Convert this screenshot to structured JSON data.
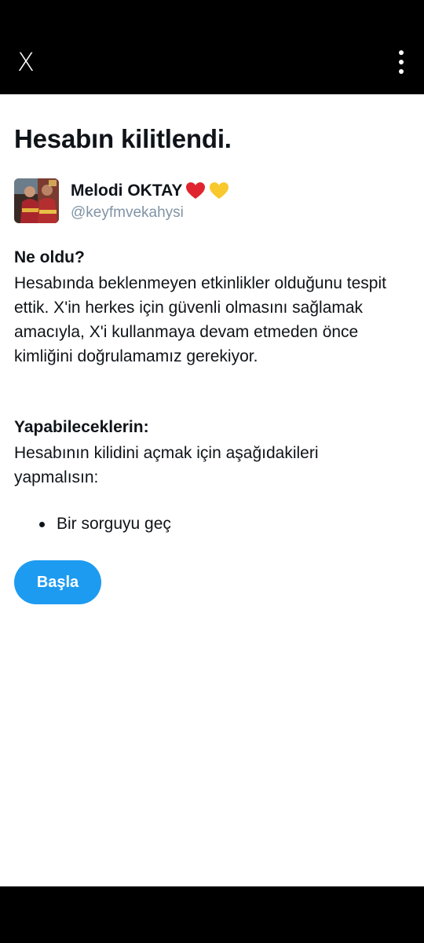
{
  "topbar": {
    "close_label": "X",
    "close_icon": "close-x-icon",
    "more_icon": "more-vertical-icon"
  },
  "page": {
    "title": "Hesabın kilitlendi."
  },
  "profile": {
    "display_name": "Melodi OKTAY",
    "emojis": [
      "red-heart",
      "yellow-heart"
    ],
    "handle": "@keyfmvekahysi"
  },
  "what_happened": {
    "heading": "Ne oldu?",
    "body": "Hesabında beklenmeyen etkinlikler olduğunu tespit ettik. X'in herkes için güvenli olmasını sağlamak amacıyla, X'i kullanmaya devam etmeden önce kimliğini doğrulamamız gerekiyor."
  },
  "what_you_can_do": {
    "heading": "Yapabileceklerin:",
    "body": "Hesabının kilidini açmak için aşağıdakileri yapmalısın:",
    "items": [
      "Bir sorguyu geç"
    ]
  },
  "actions": {
    "start_label": "Başla"
  },
  "colors": {
    "accent": "#1d9bf0",
    "text": "#0f1419",
    "secondary_text": "#8094a6",
    "bars": "#000000"
  }
}
